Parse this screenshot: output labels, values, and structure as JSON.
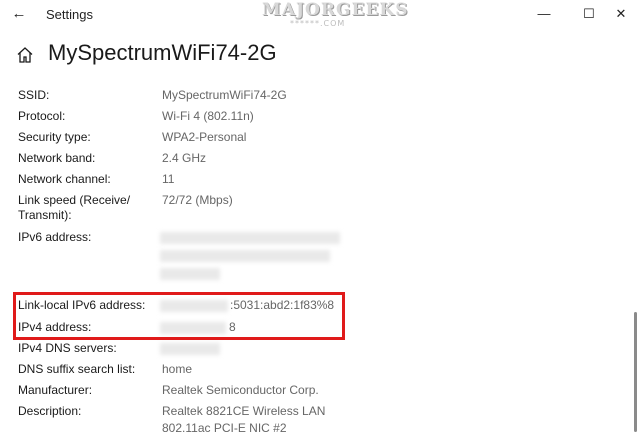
{
  "window": {
    "title": "Settings",
    "back_icon": "←",
    "minimize_icon": "—",
    "maximize_icon": "☐",
    "close_icon": "✕"
  },
  "watermark": {
    "brand": "MAJORGEEKS",
    "sub": "******.COM"
  },
  "page": {
    "title": "MySpectrumWiFi74-2G"
  },
  "properties": [
    {
      "label": "SSID:",
      "value": "MySpectrumWiFi74-2G"
    },
    {
      "label": "Protocol:",
      "value": "Wi-Fi 4 (802.11n)"
    },
    {
      "label": "Security type:",
      "value": "WPA2-Personal"
    },
    {
      "label": "Network band:",
      "value": "2.4 GHz"
    },
    {
      "label": "Network channel:",
      "value": "11"
    },
    {
      "label": "Link speed (Receive/",
      "label2": "Transmit):",
      "value": "72/72 (Mbps)"
    },
    {
      "label": "IPv6 address:",
      "value": ""
    },
    {
      "label": "Link-local IPv6 address:",
      "value": ":5031:abd2:1f83%8"
    },
    {
      "label": "IPv4 address:",
      "value": "8"
    },
    {
      "label": "IPv4 DNS servers:",
      "value": ""
    },
    {
      "label": "DNS suffix search list:",
      "value": "home"
    },
    {
      "label": "Manufacturer:",
      "value": "Realtek Semiconductor Corp."
    },
    {
      "label": "Description:",
      "value": "Realtek 8821CE Wireless LAN",
      "value2": "802.11ac PCI-E NIC #2"
    }
  ],
  "colors": {
    "highlight": "#e01a1a",
    "label": "#1a1a1a",
    "value": "#666666"
  }
}
